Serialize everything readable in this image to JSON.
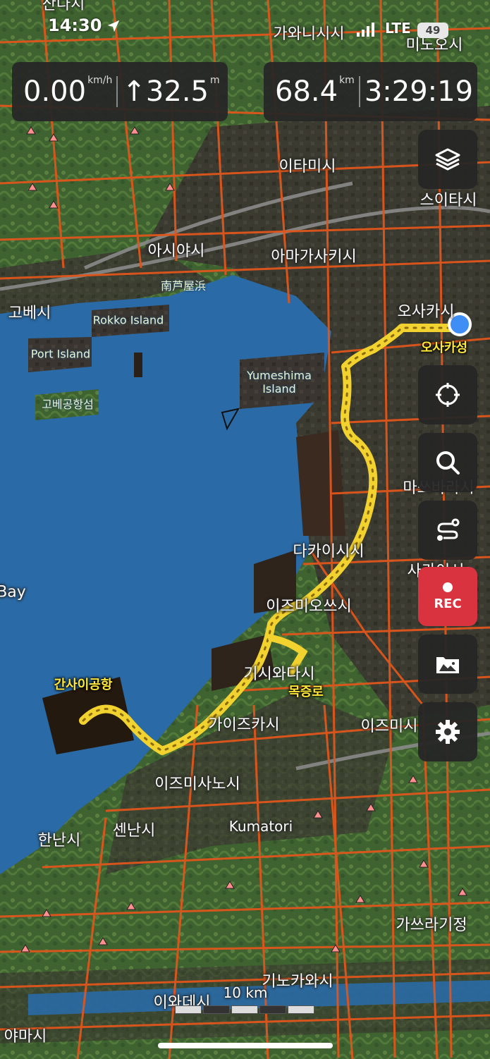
{
  "status_bar": {
    "time": "14:30",
    "network": "LTE",
    "battery": "49"
  },
  "speed_panel": {
    "speed": "0.00",
    "speed_unit": "km/h",
    "ascent": "↑32.5",
    "ascent_unit": "m"
  },
  "trip_panel": {
    "distance": "68.4",
    "distance_unit": "km",
    "duration": "3:29:19"
  },
  "buttons": {
    "rec_label": "REC"
  },
  "map": {
    "scale_label": "10 km",
    "route_color": "#f2d22e",
    "water_color": "#2a6aa6",
    "road_color": "#e0561c",
    "current_location_color": "#3f8ef5",
    "labels": {
      "kawanishi": "가와니시시",
      "minoh": "미노오시",
      "itami": "이타미시",
      "suita": "스이타시",
      "ashiya": "아시야시",
      "amagasaki": "아마가사키시",
      "nanko": "南芦屋浜",
      "kobe": "고베시",
      "rokko": "Rokko Island",
      "osaka": "오사카시",
      "port_island": "Port Island",
      "kobe_airport": "고베공항섬",
      "yumeshima": "Yumeshima\nIsland",
      "osaka_castle": "오사카성",
      "matsubara": "마쓰바라시",
      "takaishi": "다카이시시",
      "sakai": "사카이시",
      "bay": "Bay",
      "izumiotsu": "이즈미오쓰시",
      "kishiwada": "기시와다시",
      "kansai_airport": "간사이공항",
      "mokjeungro": "목증로",
      "kaizuka": "가이즈카시",
      "izumi": "이즈미시",
      "izumisano": "이즈미사노시",
      "kumatori": "Kumatori",
      "hannan": "한난시",
      "sennan": "센난시",
      "kazuragi": "가쓰라기정",
      "kinokawa": "기노카와시",
      "iwade": "이와데시",
      "yamashi": "야마시",
      "top_partial": "산다시"
    }
  }
}
